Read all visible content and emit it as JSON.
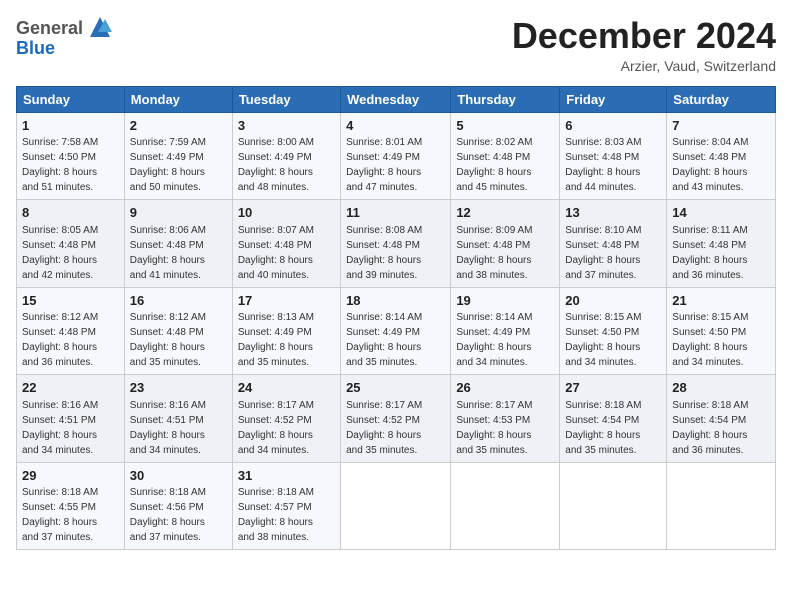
{
  "header": {
    "logo_line1": "General",
    "logo_line2": "Blue",
    "month_title": "December 2024",
    "location": "Arzier, Vaud, Switzerland"
  },
  "weekdays": [
    "Sunday",
    "Monday",
    "Tuesday",
    "Wednesday",
    "Thursday",
    "Friday",
    "Saturday"
  ],
  "weeks": [
    [
      {
        "day": "1",
        "sunrise": "7:58 AM",
        "sunset": "4:50 PM",
        "daylight": "8 hours and 51 minutes."
      },
      {
        "day": "2",
        "sunrise": "7:59 AM",
        "sunset": "4:49 PM",
        "daylight": "8 hours and 50 minutes."
      },
      {
        "day": "3",
        "sunrise": "8:00 AM",
        "sunset": "4:49 PM",
        "daylight": "8 hours and 48 minutes."
      },
      {
        "day": "4",
        "sunrise": "8:01 AM",
        "sunset": "4:49 PM",
        "daylight": "8 hours and 47 minutes."
      },
      {
        "day": "5",
        "sunrise": "8:02 AM",
        "sunset": "4:48 PM",
        "daylight": "8 hours and 45 minutes."
      },
      {
        "day": "6",
        "sunrise": "8:03 AM",
        "sunset": "4:48 PM",
        "daylight": "8 hours and 44 minutes."
      },
      {
        "day": "7",
        "sunrise": "8:04 AM",
        "sunset": "4:48 PM",
        "daylight": "8 hours and 43 minutes."
      }
    ],
    [
      {
        "day": "8",
        "sunrise": "8:05 AM",
        "sunset": "4:48 PM",
        "daylight": "8 hours and 42 minutes."
      },
      {
        "day": "9",
        "sunrise": "8:06 AM",
        "sunset": "4:48 PM",
        "daylight": "8 hours and 41 minutes."
      },
      {
        "day": "10",
        "sunrise": "8:07 AM",
        "sunset": "4:48 PM",
        "daylight": "8 hours and 40 minutes."
      },
      {
        "day": "11",
        "sunrise": "8:08 AM",
        "sunset": "4:48 PM",
        "daylight": "8 hours and 39 minutes."
      },
      {
        "day": "12",
        "sunrise": "8:09 AM",
        "sunset": "4:48 PM",
        "daylight": "8 hours and 38 minutes."
      },
      {
        "day": "13",
        "sunrise": "8:10 AM",
        "sunset": "4:48 PM",
        "daylight": "8 hours and 37 minutes."
      },
      {
        "day": "14",
        "sunrise": "8:11 AM",
        "sunset": "4:48 PM",
        "daylight": "8 hours and 36 minutes."
      }
    ],
    [
      {
        "day": "15",
        "sunrise": "8:12 AM",
        "sunset": "4:48 PM",
        "daylight": "8 hours and 36 minutes."
      },
      {
        "day": "16",
        "sunrise": "8:12 AM",
        "sunset": "4:48 PM",
        "daylight": "8 hours and 35 minutes."
      },
      {
        "day": "17",
        "sunrise": "8:13 AM",
        "sunset": "4:49 PM",
        "daylight": "8 hours and 35 minutes."
      },
      {
        "day": "18",
        "sunrise": "8:14 AM",
        "sunset": "4:49 PM",
        "daylight": "8 hours and 35 minutes."
      },
      {
        "day": "19",
        "sunrise": "8:14 AM",
        "sunset": "4:49 PM",
        "daylight": "8 hours and 34 minutes."
      },
      {
        "day": "20",
        "sunrise": "8:15 AM",
        "sunset": "4:50 PM",
        "daylight": "8 hours and 34 minutes."
      },
      {
        "day": "21",
        "sunrise": "8:15 AM",
        "sunset": "4:50 PM",
        "daylight": "8 hours and 34 minutes."
      }
    ],
    [
      {
        "day": "22",
        "sunrise": "8:16 AM",
        "sunset": "4:51 PM",
        "daylight": "8 hours and 34 minutes."
      },
      {
        "day": "23",
        "sunrise": "8:16 AM",
        "sunset": "4:51 PM",
        "daylight": "8 hours and 34 minutes."
      },
      {
        "day": "24",
        "sunrise": "8:17 AM",
        "sunset": "4:52 PM",
        "daylight": "8 hours and 34 minutes."
      },
      {
        "day": "25",
        "sunrise": "8:17 AM",
        "sunset": "4:52 PM",
        "daylight": "8 hours and 35 minutes."
      },
      {
        "day": "26",
        "sunrise": "8:17 AM",
        "sunset": "4:53 PM",
        "daylight": "8 hours and 35 minutes."
      },
      {
        "day": "27",
        "sunrise": "8:18 AM",
        "sunset": "4:54 PM",
        "daylight": "8 hours and 35 minutes."
      },
      {
        "day": "28",
        "sunrise": "8:18 AM",
        "sunset": "4:54 PM",
        "daylight": "8 hours and 36 minutes."
      }
    ],
    [
      {
        "day": "29",
        "sunrise": "8:18 AM",
        "sunset": "4:55 PM",
        "daylight": "8 hours and 37 minutes."
      },
      {
        "day": "30",
        "sunrise": "8:18 AM",
        "sunset": "4:56 PM",
        "daylight": "8 hours and 37 minutes."
      },
      {
        "day": "31",
        "sunrise": "8:18 AM",
        "sunset": "4:57 PM",
        "daylight": "8 hours and 38 minutes."
      },
      null,
      null,
      null,
      null
    ]
  ]
}
